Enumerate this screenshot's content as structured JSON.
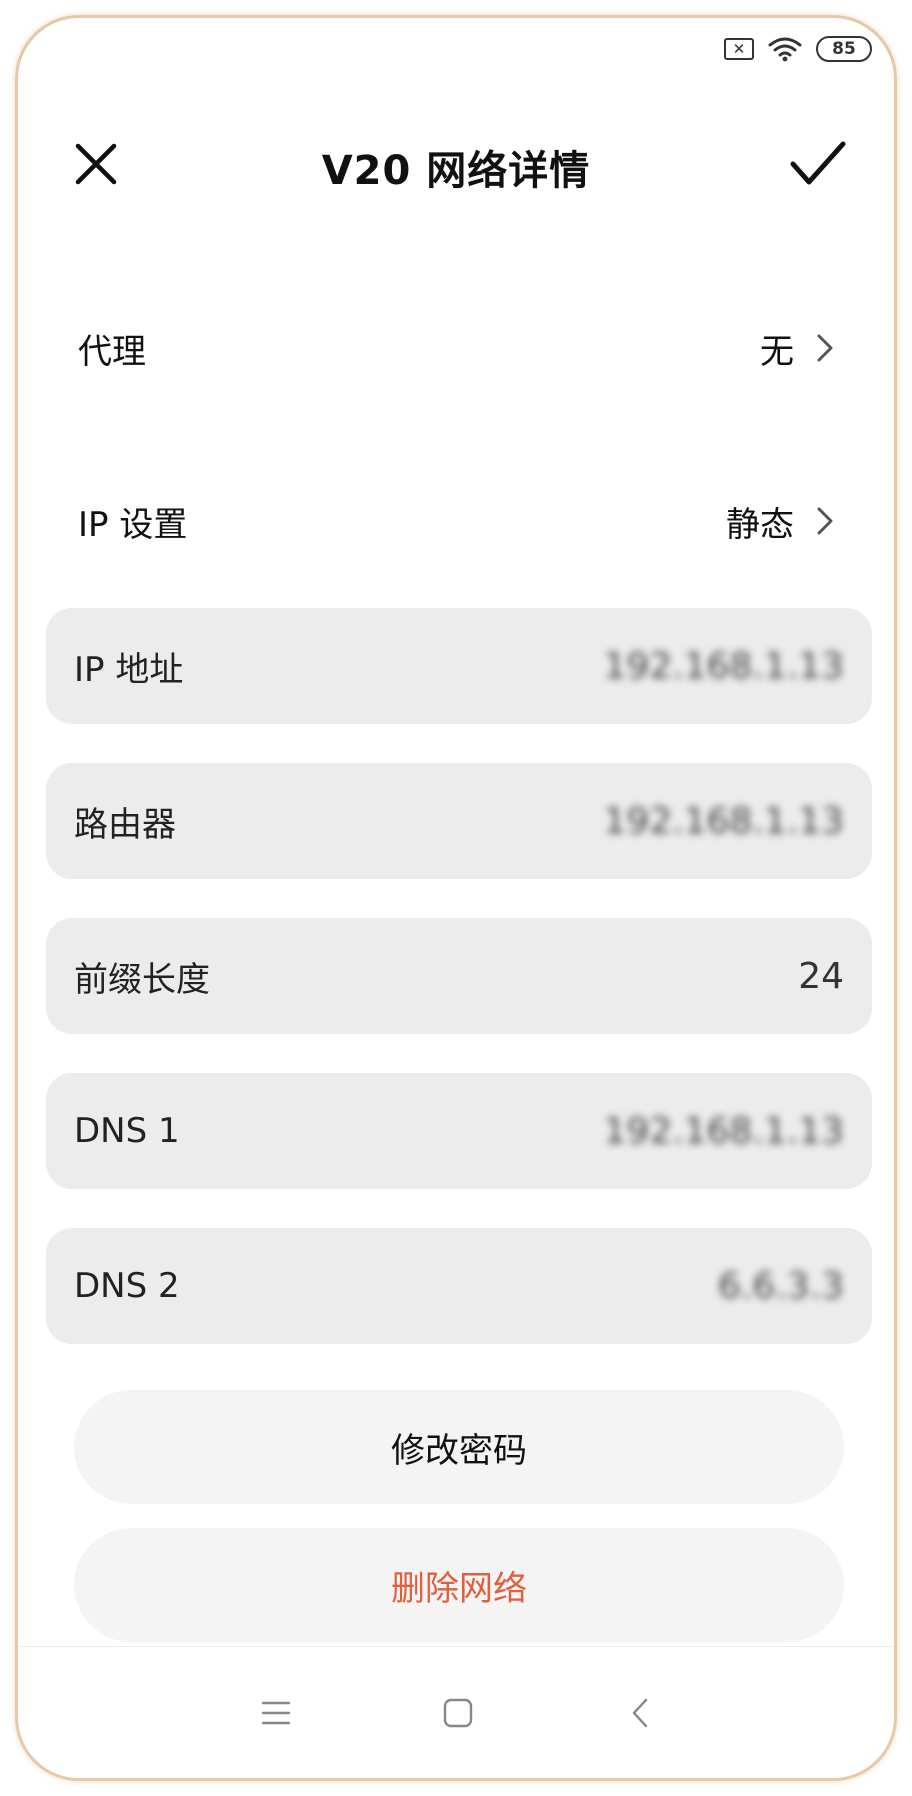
{
  "status_bar": {
    "sim_icon": "sim-x-icon",
    "sim_glyph": "✕",
    "wifi_icon": "wifi-icon",
    "battery_level": "85"
  },
  "header": {
    "title": "V20 网络详情",
    "close_icon": "close-icon",
    "confirm_icon": "checkmark-icon"
  },
  "settings": {
    "proxy": {
      "label": "代理",
      "value": "无"
    },
    "ip_settings": {
      "label": "IP 设置",
      "value": "静态"
    }
  },
  "info": {
    "ip_address": {
      "label": "IP 地址",
      "value": "192.168.1.13"
    },
    "router": {
      "label": "路由器",
      "value": "192.168.1.13"
    },
    "prefix_length": {
      "label": "前缀长度",
      "value": "24"
    },
    "dns1": {
      "label": "DNS 1",
      "value": "192.168.1.13"
    },
    "dns2": {
      "label": "DNS 2",
      "value": "6.6.3.3"
    }
  },
  "actions": {
    "change_password": "修改密码",
    "delete_network": "删除网络"
  },
  "colors": {
    "delete_text": "#e0603e",
    "card_bg": "#ececec",
    "frame_border": "#e8c9a6"
  },
  "nav": {
    "menu_icon": "menu-icon",
    "home_icon": "home-icon",
    "back_icon": "back-icon"
  }
}
